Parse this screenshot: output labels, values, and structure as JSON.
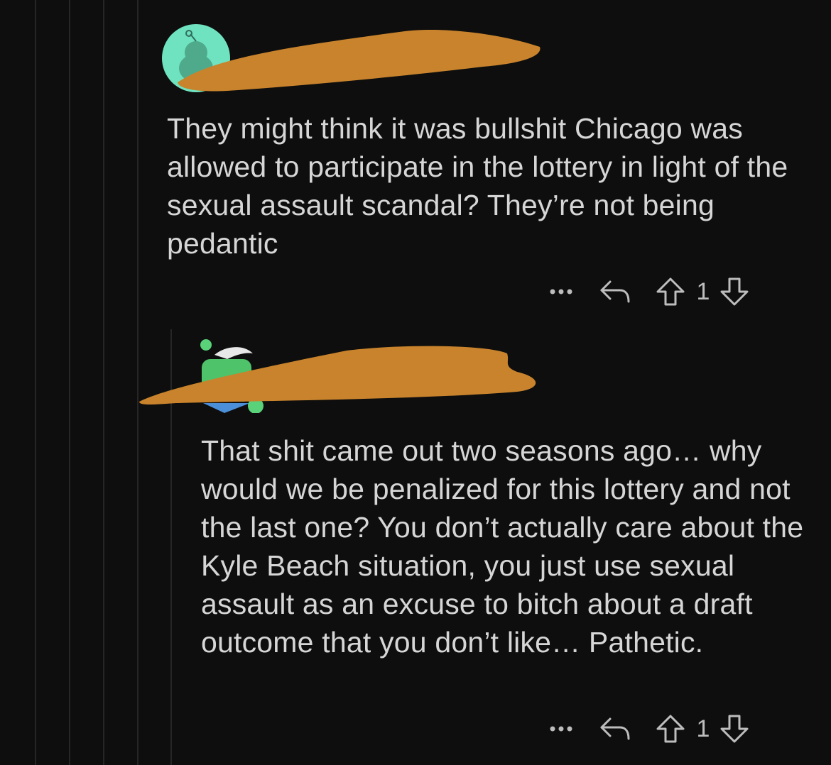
{
  "comments": [
    {
      "username": "",
      "body": "They might think it was bullshit Chicago was allowed to participate in the lottery in light of the sexual assault scandal? They’re not being pedantic",
      "score": "1",
      "more_icon": "more-dots-icon",
      "reply_icon": "reply-arrow-icon",
      "upvote_icon": "upvote-arrow-icon",
      "downvote_icon": "downvote-arrow-icon"
    },
    {
      "username": "",
      "body": "That shit came out two seasons ago… why would we be penalized for this lottery and not the last one? You don’t actually care about the Kyle Beach situation, you just use sexual assault as an excuse to bitch about a draft outcome that you don’t like… Pathetic.",
      "score": "1",
      "more_icon": "more-dots-icon",
      "reply_icon": "reply-arrow-icon",
      "upvote_icon": "upvote-arrow-icon",
      "downvote_icon": "downvote-arrow-icon"
    }
  ],
  "colors": {
    "background": "#0e0e0e",
    "text": "#d6d6d6",
    "redaction": "#c8832c",
    "avatar_teal": "#6fe3bf",
    "thread_line": "#262626"
  }
}
